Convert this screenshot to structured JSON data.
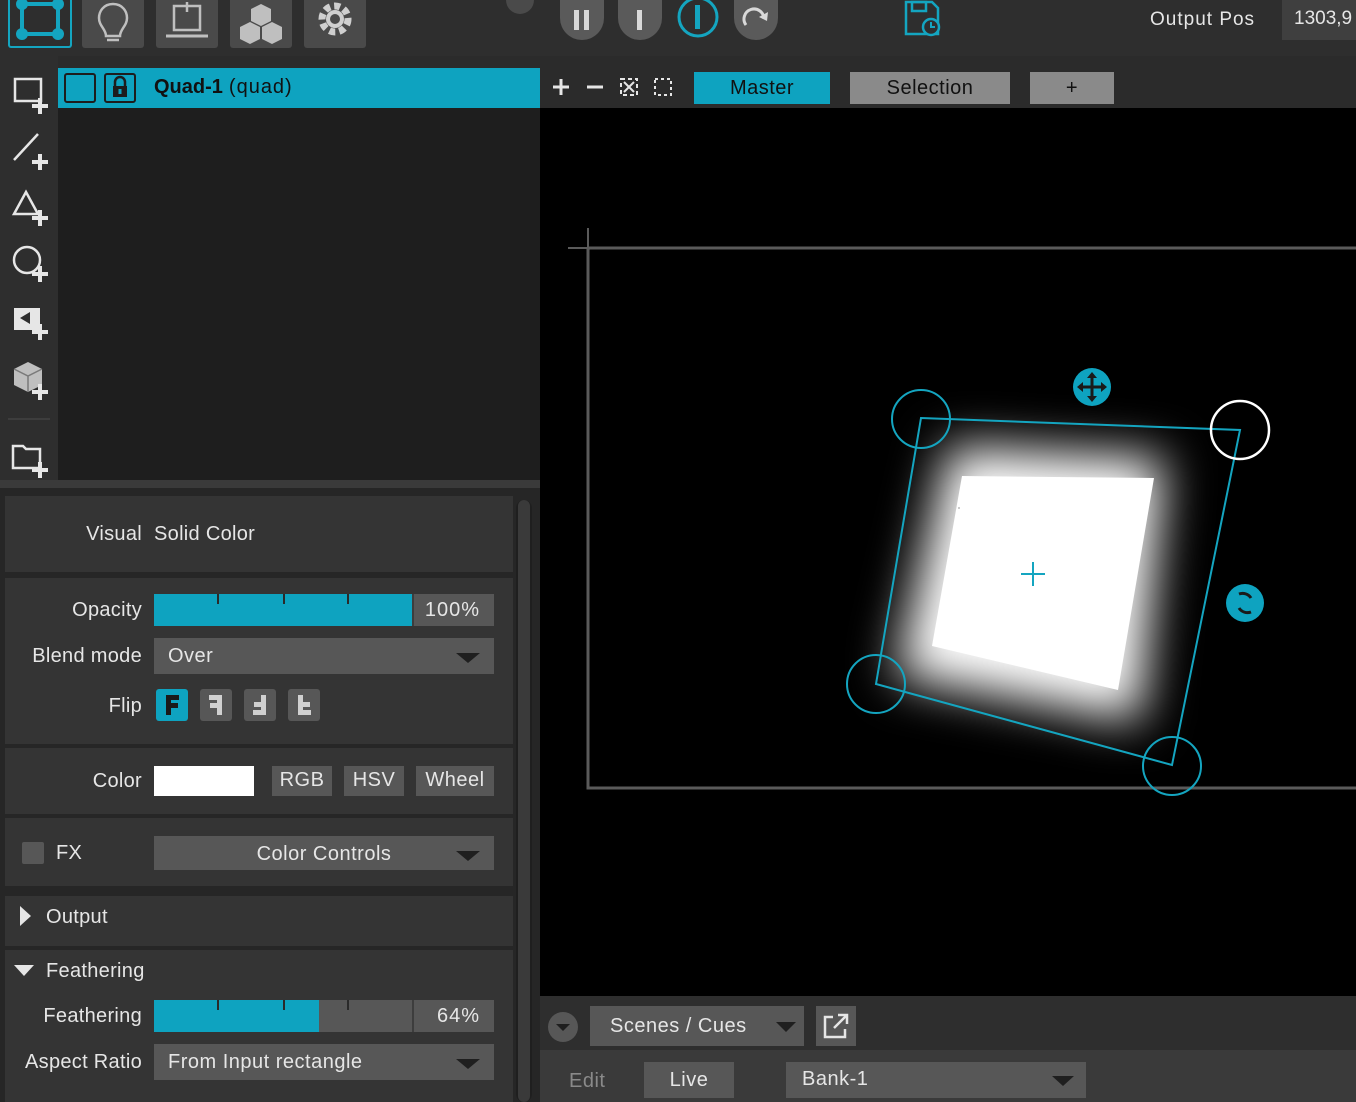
{
  "toolbar": {
    "tools": [
      {
        "name": "mapping-mode-icon",
        "active": true
      },
      {
        "name": "lightbulb-icon",
        "active": false
      },
      {
        "name": "output-stand-icon",
        "active": false
      },
      {
        "name": "cubes-icon",
        "active": false
      },
      {
        "name": "gear-icon",
        "active": false
      }
    ],
    "transport": [
      "pause-icon",
      "stop-icon",
      "play-icon",
      "redo-icon"
    ],
    "save_icon": "save-timer-icon",
    "output_pos_label": "Output Pos",
    "output_pos_value": "1303,9"
  },
  "side_tools": [
    "add-rectangle-icon",
    "add-line-icon",
    "add-triangle-icon",
    "add-circle-icon",
    "add-mask-icon",
    "add-3d-object-icon",
    "add-from-folder-icon"
  ],
  "layer": {
    "name": "Quad-1",
    "kind": "(quad)"
  },
  "inspector": {
    "visual_label": "Visual",
    "visual_value": "Solid Color",
    "opacity_label": "Opacity",
    "opacity_value": 100,
    "opacity_text": "100%",
    "blend_label": "Blend mode",
    "blend_value": "Over",
    "flip_label": "Flip",
    "flip_options": [
      "F",
      "Ⅎ",
      "Ⅎ",
      "L"
    ],
    "color_label": "Color",
    "color_value": "#ffffff",
    "color_buttons": [
      "RGB",
      "HSV",
      "Wheel"
    ],
    "fx_label": "FX",
    "fx_value": "Color Controls",
    "output_section": "Output",
    "feathering_section": "Feathering",
    "feathering_label": "Feathering",
    "feathering_value": 64,
    "feathering_text": "64%",
    "aspect_label": "Aspect Ratio",
    "aspect_value": "From Input rectangle"
  },
  "view": {
    "tabs": [
      "Master",
      "Selection",
      "+"
    ],
    "active_tab": "Master"
  },
  "bottom": {
    "scenes_label": "Scenes / Cues",
    "edit_label": "Edit",
    "live_label": "Live",
    "bank_value": "Bank-1"
  },
  "colors": {
    "accent": "#0ea3c0",
    "panel": "#343434",
    "control": "#575757"
  }
}
